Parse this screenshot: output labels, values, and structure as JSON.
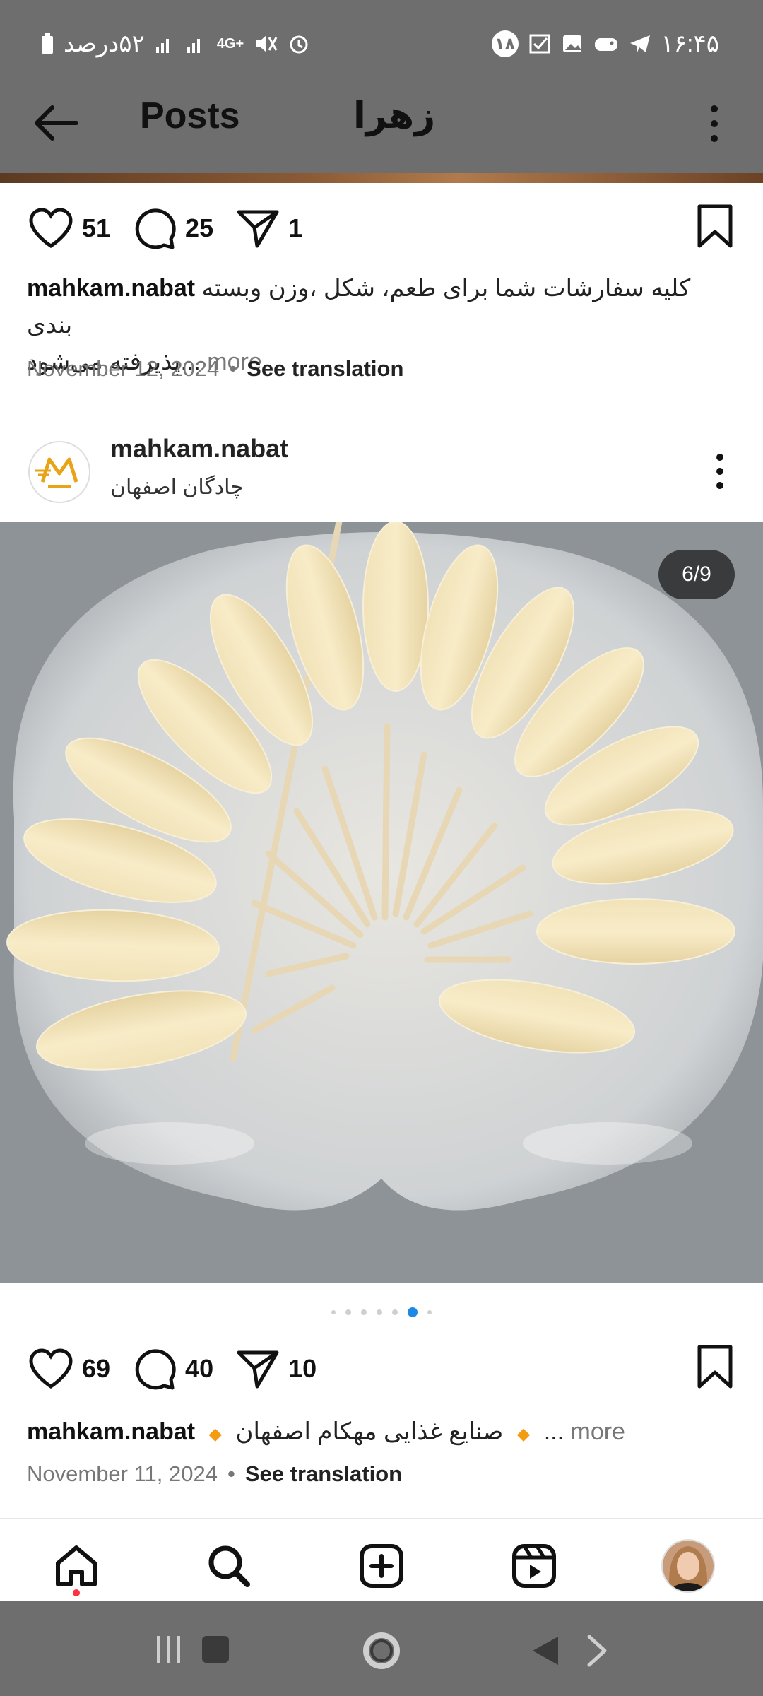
{
  "status_bar": {
    "left_text": "۵۲درصد",
    "network": "4G+",
    "time": "۱۶:۴۵",
    "notification_count": "۱۸"
  },
  "app_bar": {
    "title": "Posts",
    "username": "زهرا"
  },
  "post_top": {
    "likes": "51",
    "comments": "25",
    "shares": "1",
    "caption_user": "mahkam.nabat",
    "caption_line1": "کلیه سفارشات شما برای طعم، شکل ،وزن وبسته بندی",
    "caption_line2": "...پذیرفته می‌شود",
    "more_label": "more",
    "date": "November 12, 2024",
    "see_translation": "See translation"
  },
  "post": {
    "username": "mahkam.nabat",
    "location": "چادگان اصفهان",
    "pager": "6/9",
    "carousel_total": 7,
    "carousel_active": 6,
    "likes": "69",
    "comments": "40",
    "shares": "10",
    "caption_user": "mahkam.nabat",
    "caption_text": "صنایع غذایی مهکام اصفهان",
    "caption_ellipsis": "...",
    "more_label": "more",
    "date": "November 11, 2024",
    "see_translation": "See translation"
  },
  "colors": {
    "status_bg": "#6e6e6e",
    "accent_blue": "#1e88e5",
    "notification_red": "#ff3040",
    "diamond_orange": "#f39c12"
  },
  "icons": {
    "nav": [
      "home-icon",
      "search-icon",
      "create-icon",
      "reels-icon",
      "profile-avatar"
    ]
  }
}
